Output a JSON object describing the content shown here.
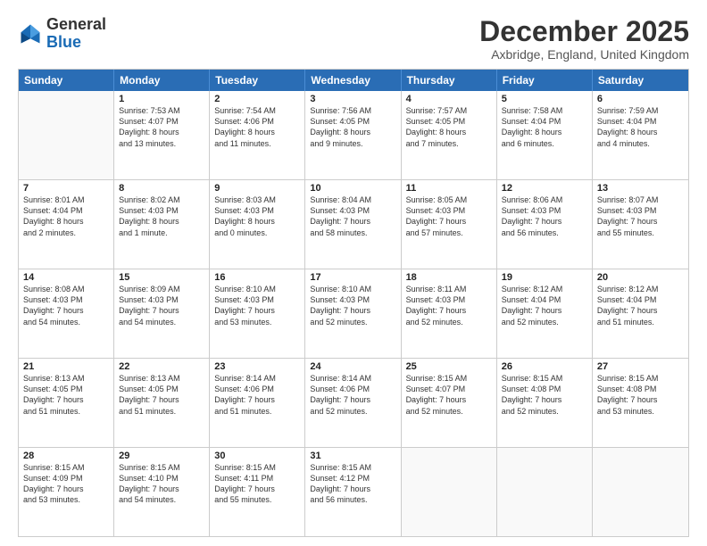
{
  "header": {
    "logo_general": "General",
    "logo_blue": "Blue",
    "month_title": "December 2025",
    "location": "Axbridge, England, United Kingdom"
  },
  "weekdays": [
    "Sunday",
    "Monday",
    "Tuesday",
    "Wednesday",
    "Thursday",
    "Friday",
    "Saturday"
  ],
  "weeks": [
    [
      {
        "day": "",
        "info": ""
      },
      {
        "day": "1",
        "info": "Sunrise: 7:53 AM\nSunset: 4:07 PM\nDaylight: 8 hours\nand 13 minutes."
      },
      {
        "day": "2",
        "info": "Sunrise: 7:54 AM\nSunset: 4:06 PM\nDaylight: 8 hours\nand 11 minutes."
      },
      {
        "day": "3",
        "info": "Sunrise: 7:56 AM\nSunset: 4:05 PM\nDaylight: 8 hours\nand 9 minutes."
      },
      {
        "day": "4",
        "info": "Sunrise: 7:57 AM\nSunset: 4:05 PM\nDaylight: 8 hours\nand 7 minutes."
      },
      {
        "day": "5",
        "info": "Sunrise: 7:58 AM\nSunset: 4:04 PM\nDaylight: 8 hours\nand 6 minutes."
      },
      {
        "day": "6",
        "info": "Sunrise: 7:59 AM\nSunset: 4:04 PM\nDaylight: 8 hours\nand 4 minutes."
      }
    ],
    [
      {
        "day": "7",
        "info": "Sunrise: 8:01 AM\nSunset: 4:04 PM\nDaylight: 8 hours\nand 2 minutes."
      },
      {
        "day": "8",
        "info": "Sunrise: 8:02 AM\nSunset: 4:03 PM\nDaylight: 8 hours\nand 1 minute."
      },
      {
        "day": "9",
        "info": "Sunrise: 8:03 AM\nSunset: 4:03 PM\nDaylight: 8 hours\nand 0 minutes."
      },
      {
        "day": "10",
        "info": "Sunrise: 8:04 AM\nSunset: 4:03 PM\nDaylight: 7 hours\nand 58 minutes."
      },
      {
        "day": "11",
        "info": "Sunrise: 8:05 AM\nSunset: 4:03 PM\nDaylight: 7 hours\nand 57 minutes."
      },
      {
        "day": "12",
        "info": "Sunrise: 8:06 AM\nSunset: 4:03 PM\nDaylight: 7 hours\nand 56 minutes."
      },
      {
        "day": "13",
        "info": "Sunrise: 8:07 AM\nSunset: 4:03 PM\nDaylight: 7 hours\nand 55 minutes."
      }
    ],
    [
      {
        "day": "14",
        "info": "Sunrise: 8:08 AM\nSunset: 4:03 PM\nDaylight: 7 hours\nand 54 minutes."
      },
      {
        "day": "15",
        "info": "Sunrise: 8:09 AM\nSunset: 4:03 PM\nDaylight: 7 hours\nand 54 minutes."
      },
      {
        "day": "16",
        "info": "Sunrise: 8:10 AM\nSunset: 4:03 PM\nDaylight: 7 hours\nand 53 minutes."
      },
      {
        "day": "17",
        "info": "Sunrise: 8:10 AM\nSunset: 4:03 PM\nDaylight: 7 hours\nand 52 minutes."
      },
      {
        "day": "18",
        "info": "Sunrise: 8:11 AM\nSunset: 4:03 PM\nDaylight: 7 hours\nand 52 minutes."
      },
      {
        "day": "19",
        "info": "Sunrise: 8:12 AM\nSunset: 4:04 PM\nDaylight: 7 hours\nand 52 minutes."
      },
      {
        "day": "20",
        "info": "Sunrise: 8:12 AM\nSunset: 4:04 PM\nDaylight: 7 hours\nand 51 minutes."
      }
    ],
    [
      {
        "day": "21",
        "info": "Sunrise: 8:13 AM\nSunset: 4:05 PM\nDaylight: 7 hours\nand 51 minutes."
      },
      {
        "day": "22",
        "info": "Sunrise: 8:13 AM\nSunset: 4:05 PM\nDaylight: 7 hours\nand 51 minutes."
      },
      {
        "day": "23",
        "info": "Sunrise: 8:14 AM\nSunset: 4:06 PM\nDaylight: 7 hours\nand 51 minutes."
      },
      {
        "day": "24",
        "info": "Sunrise: 8:14 AM\nSunset: 4:06 PM\nDaylight: 7 hours\nand 52 minutes."
      },
      {
        "day": "25",
        "info": "Sunrise: 8:15 AM\nSunset: 4:07 PM\nDaylight: 7 hours\nand 52 minutes."
      },
      {
        "day": "26",
        "info": "Sunrise: 8:15 AM\nSunset: 4:08 PM\nDaylight: 7 hours\nand 52 minutes."
      },
      {
        "day": "27",
        "info": "Sunrise: 8:15 AM\nSunset: 4:08 PM\nDaylight: 7 hours\nand 53 minutes."
      }
    ],
    [
      {
        "day": "28",
        "info": "Sunrise: 8:15 AM\nSunset: 4:09 PM\nDaylight: 7 hours\nand 53 minutes."
      },
      {
        "day": "29",
        "info": "Sunrise: 8:15 AM\nSunset: 4:10 PM\nDaylight: 7 hours\nand 54 minutes."
      },
      {
        "day": "30",
        "info": "Sunrise: 8:15 AM\nSunset: 4:11 PM\nDaylight: 7 hours\nand 55 minutes."
      },
      {
        "day": "31",
        "info": "Sunrise: 8:15 AM\nSunset: 4:12 PM\nDaylight: 7 hours\nand 56 minutes."
      },
      {
        "day": "",
        "info": ""
      },
      {
        "day": "",
        "info": ""
      },
      {
        "day": "",
        "info": ""
      }
    ]
  ]
}
